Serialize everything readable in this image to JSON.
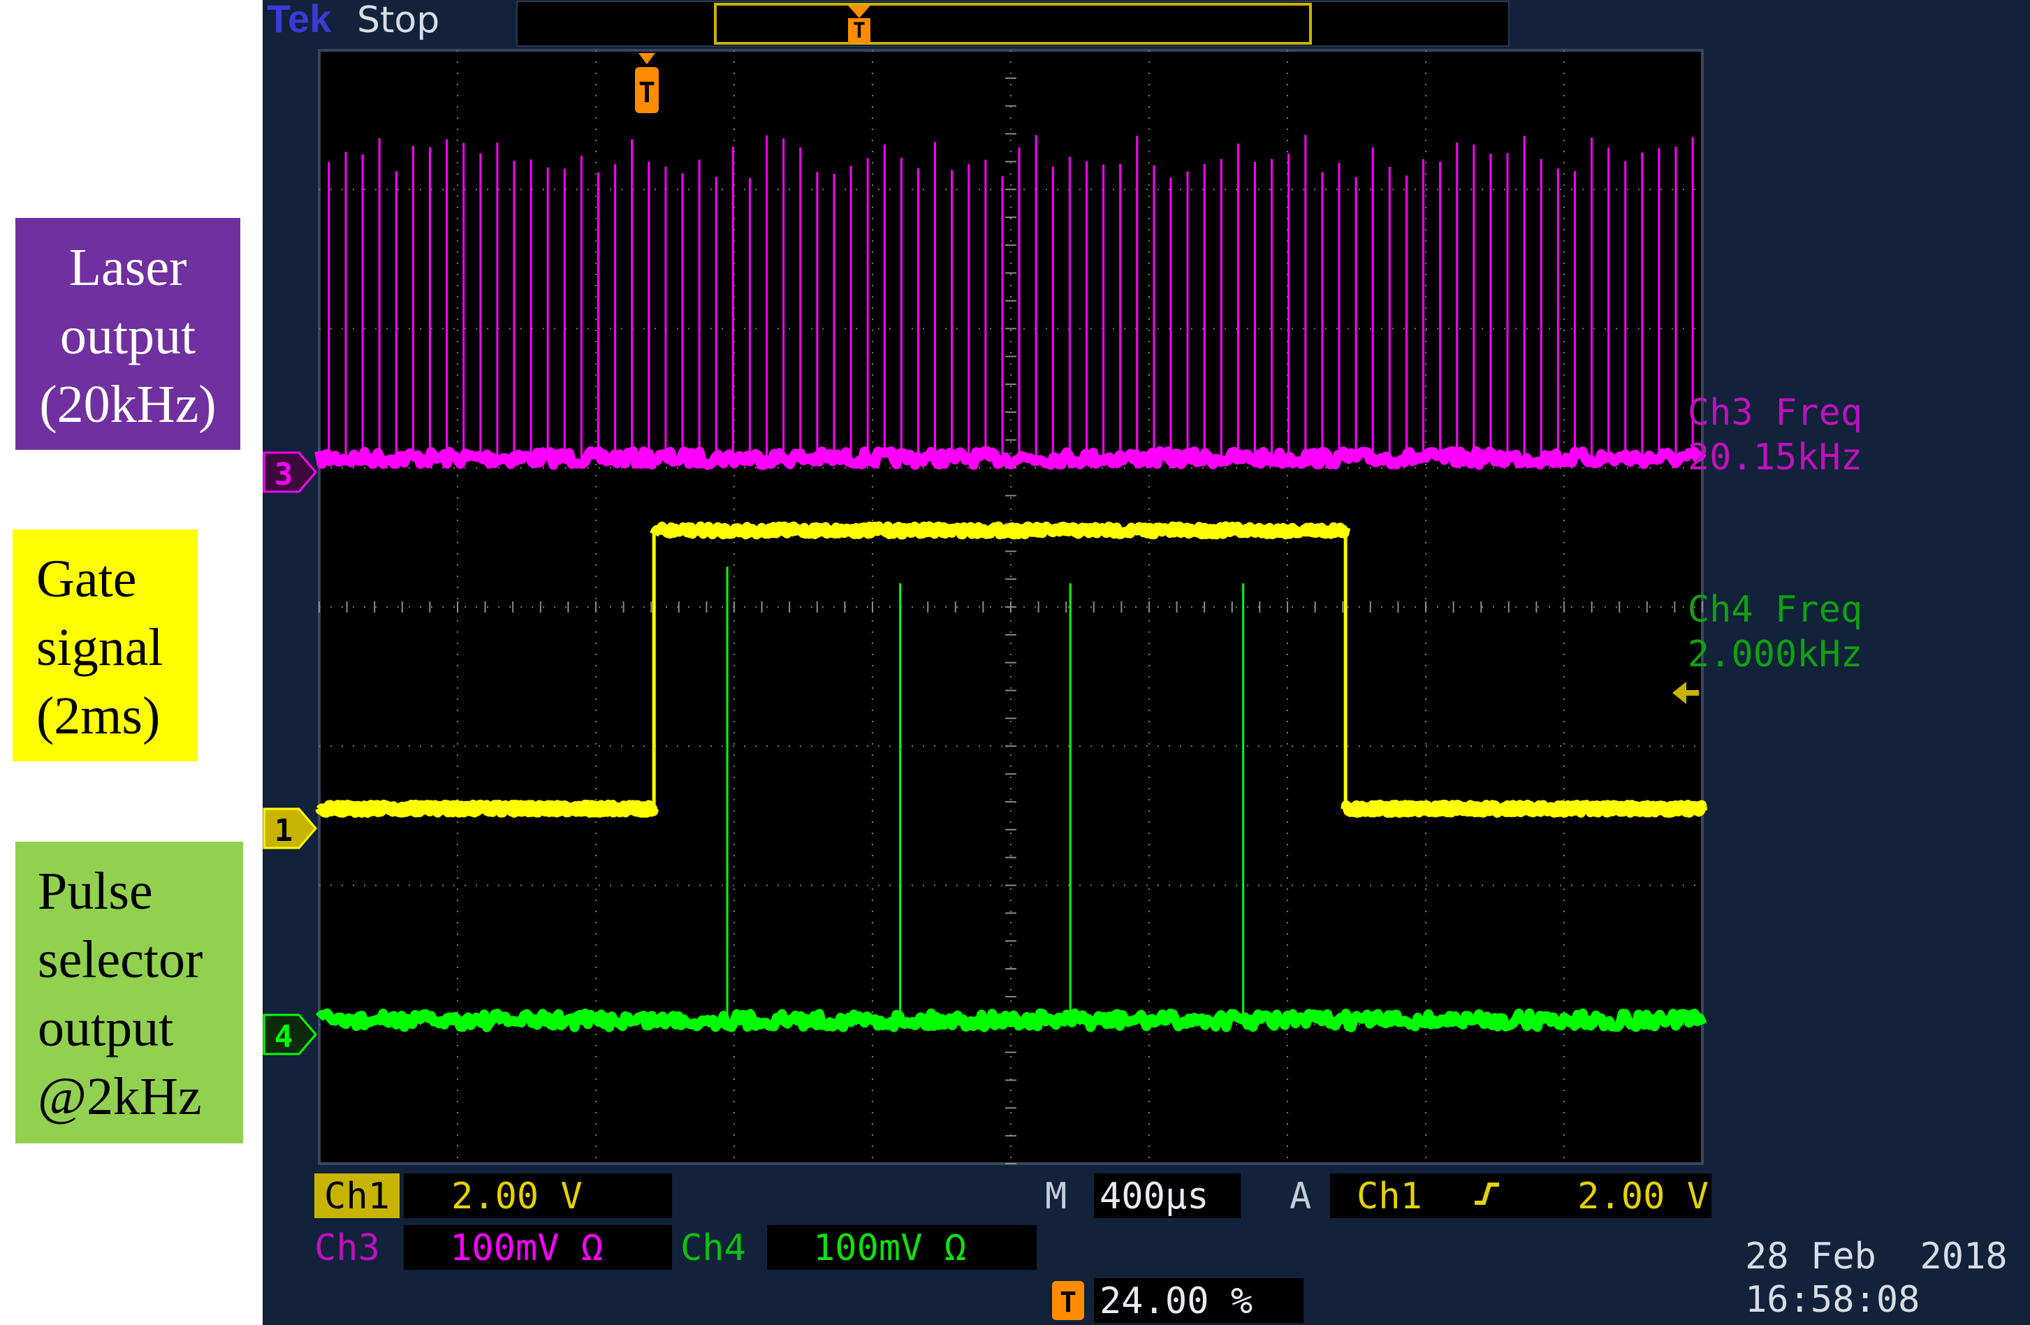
{
  "annotations": {
    "laser": [
      "Laser",
      "output",
      "(20kHz)"
    ],
    "gate": [
      "Gate",
      "signal",
      "(2ms)"
    ],
    "pulse": [
      "Pulse",
      "selector",
      "output",
      "@2kHz"
    ]
  },
  "scope": {
    "brand": "Tek",
    "run_state": "Stop",
    "trigger_marker": "T",
    "channel_markers": {
      "ch3": "3",
      "ch1": "1",
      "ch4": "4"
    },
    "measurements": {
      "ch3_label": "Ch3 Freq",
      "ch3_value": "20.15kHz",
      "ch4_label": "Ch4 Freq",
      "ch4_value": "2.000kHz"
    },
    "status": {
      "ch1_name": "Ch1",
      "ch1_scale": "2.00 V",
      "ch3_name": "Ch3",
      "ch3_scale": "100mV Ω",
      "ch4_name": "Ch4",
      "ch4_scale": "100mV Ω",
      "timebase_prefix": "M",
      "timebase": "400µs",
      "trigger_prefix": "A",
      "trigger_source": "Ch1",
      "trigger_level": "2.00 V",
      "trigger_position": "24.00 %"
    },
    "date": "28 Feb  2018",
    "time": "16:58:08"
  },
  "colors": {
    "ch1": "#ffff00",
    "ch3": "#ff00ff",
    "ch4": "#00ff00",
    "screen_bg": "#000000",
    "frame_bg": "#11223a",
    "trigger": "#ff8c00"
  },
  "chart_data": {
    "type": "line",
    "x_unit": "div",
    "xlim": [
      0,
      10
    ],
    "ylim": [
      -4,
      4
    ],
    "grid": true,
    "series": [
      {
        "name": "Ch3",
        "baseline_div": 1.07,
        "pulse_peak_div": 3.4,
        "pulse_count": 82,
        "frequency": "20.15kHz"
      },
      {
        "name": "Ch1",
        "low_div": -1.45,
        "high_div": 0.55,
        "rise_div": 2.42,
        "fall_div": 7.42
      },
      {
        "name": "Ch4",
        "baseline_div": -2.97,
        "pulse_peak_div": 0.17,
        "pulse_times_div": [
          2.95,
          4.2,
          5.43,
          6.68
        ],
        "frequency": "2.000kHz"
      }
    ]
  }
}
